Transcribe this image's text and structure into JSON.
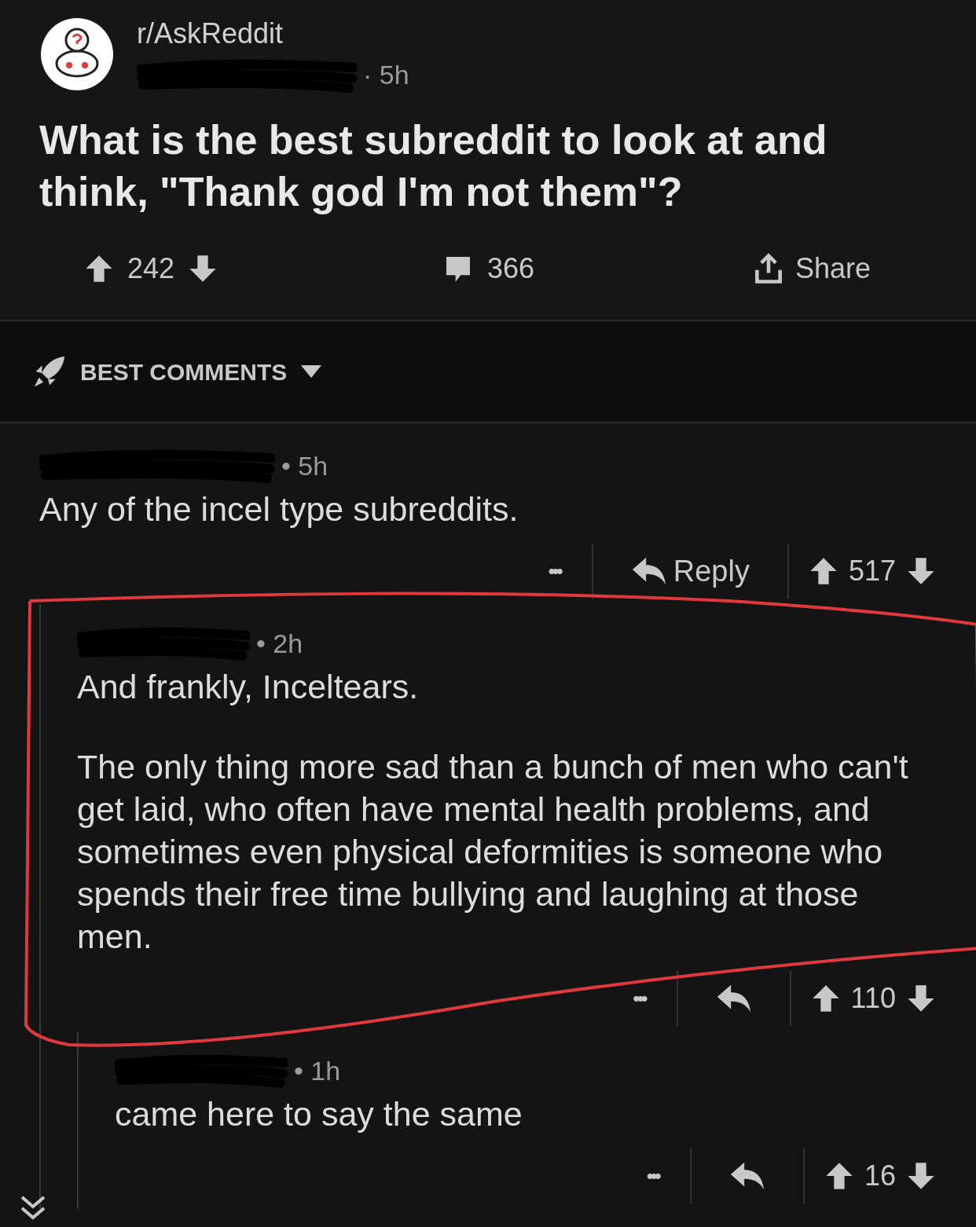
{
  "post": {
    "subreddit": "r/AskReddit",
    "time": "· 5h",
    "title": "What is the best subreddit to look at and think, \"Thank god I'm not them\"?",
    "score": "242",
    "comments": "366",
    "share": "Share"
  },
  "sort": {
    "label": "BEST COMMENTS"
  },
  "comments": [
    {
      "time": "• 5h",
      "body": [
        "Any of the incel type subreddits."
      ],
      "more": "•••",
      "reply": "Reply",
      "score": "517",
      "children": [
        {
          "time": "• 2h",
          "body": [
            "And frankly, Inceltears.",
            "The only thing more sad than a bunch of men who can't get laid, who often have mental health problems, and sometimes even physical deformities is someone who spends their free time bullying and laughing at those men."
          ],
          "more": "•••",
          "score": "110",
          "highlighted": true,
          "children": [
            {
              "time": "• 1h",
              "body": [
                "came here to say the same"
              ],
              "more": "•••",
              "score": "16"
            }
          ]
        }
      ]
    }
  ]
}
